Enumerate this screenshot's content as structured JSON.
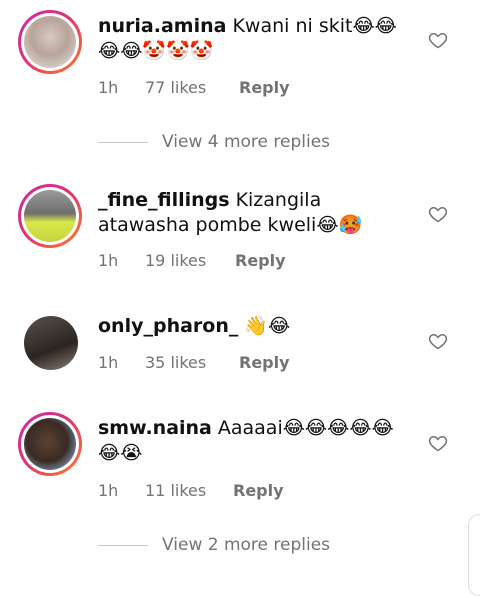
{
  "comments": [
    {
      "username": "nuria.amina",
      "text": "Kwani ni skit😂😂😂😂🤡🤡🤡",
      "time": "1h",
      "likes": "77 likes",
      "reply": "Reply",
      "view_more": "View 4 more replies",
      "story_ring": true
    },
    {
      "username": "_fine_fillings",
      "text": "Kizangila atawasha pombe kweli😂🥵",
      "time": "1h",
      "likes": "19 likes",
      "reply": "Reply",
      "story_ring": true
    },
    {
      "username": "only_pharon_",
      "text": "👋😂",
      "time": "1h",
      "likes": "35 likes",
      "reply": "Reply",
      "story_ring": false
    },
    {
      "username": "smw.naina",
      "text": "Aaaaai😂😂😂😂😂😂😭",
      "time": "1h",
      "likes": "11 likes",
      "reply": "Reply",
      "view_more": "View 2 more replies",
      "story_ring": true
    }
  ],
  "icons": {
    "like": "heart-outline-icon"
  },
  "colors": {
    "meta": "#737373",
    "ring_start": "#c92bb0",
    "ring_end": "#fd7d2d"
  }
}
